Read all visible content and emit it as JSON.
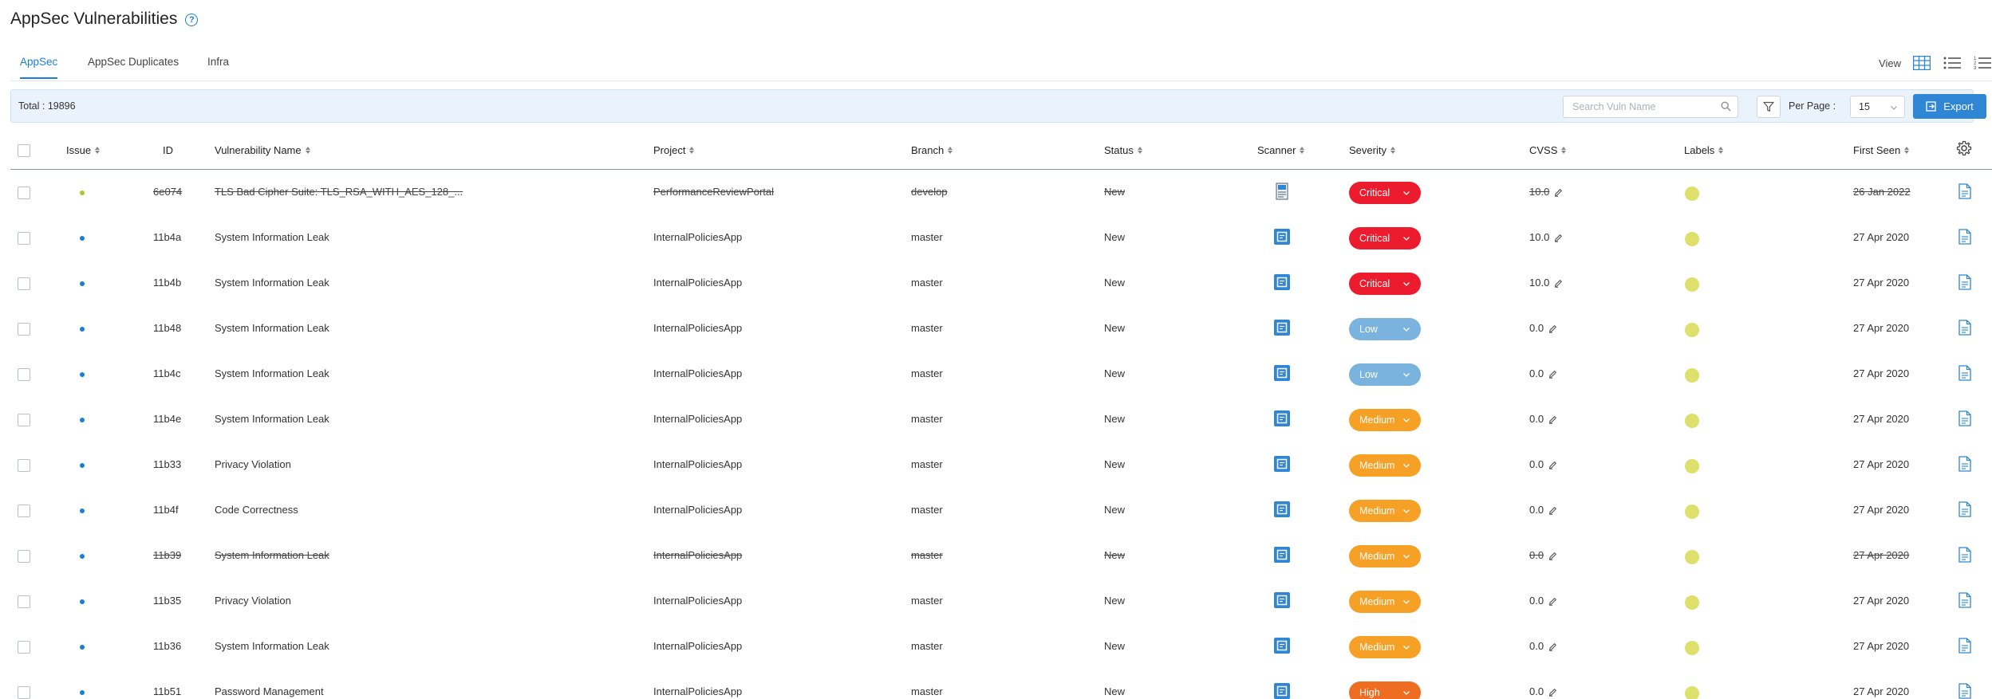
{
  "page": {
    "title": "AppSec Vulnerabilities",
    "help_icon": "help-circle-icon"
  },
  "tabs": [
    {
      "label": "AppSec",
      "active": true
    },
    {
      "label": "AppSec Duplicates",
      "active": false
    },
    {
      "label": "Infra",
      "active": false
    }
  ],
  "view": {
    "label": "View",
    "options": [
      "grid-view-icon",
      "list-view-icon",
      "numbered-list-view-icon"
    ],
    "selected": "grid-view-icon"
  },
  "toolbar": {
    "total": "Total : 19896",
    "search_placeholder": "Search Vuln Name",
    "per_page_label": "Per Page :",
    "per_page_value": "15",
    "export_label": "Export"
  },
  "columns": {
    "issue": "Issue",
    "id": "ID",
    "name": "Vulnerability Name",
    "project": "Project",
    "branch": "Branch",
    "status": "Status",
    "scanner": "Scanner",
    "severity": "Severity",
    "cvss": "CVSS",
    "labels": "Labels",
    "first_seen": "First Seen"
  },
  "colors": {
    "accent": "#1b7fd6",
    "critical": "#ec1c2e",
    "low": "#7ab4de",
    "medium": "#f6a126",
    "high": "#ef6d20",
    "label_dot": "#dde06a"
  },
  "rows": [
    {
      "issue_color": "#a9c838",
      "id": "6e074",
      "name": "TLS Bad Cipher Suite: TLS_RSA_WITH_AES_128_...",
      "project": "PerformanceReviewPortal",
      "branch": "develop",
      "status": "New",
      "scanner": "generic",
      "severity": "Critical",
      "severity_color": "#ec1c2e",
      "cvss": "10.0",
      "first_seen": "26 Jan 2022",
      "struck": true
    },
    {
      "issue_color": "#1b7fd6",
      "id": "11b4a",
      "name": "System Information Leak",
      "project": "InternalPoliciesApp",
      "branch": "master",
      "status": "New",
      "scanner": "sast",
      "severity": "Critical",
      "severity_color": "#ec1c2e",
      "cvss": "10.0",
      "first_seen": "27 Apr 2020",
      "struck": false
    },
    {
      "issue_color": "#1b7fd6",
      "id": "11b4b",
      "name": "System Information Leak",
      "project": "InternalPoliciesApp",
      "branch": "master",
      "status": "New",
      "scanner": "sast",
      "severity": "Critical",
      "severity_color": "#ec1c2e",
      "cvss": "10.0",
      "first_seen": "27 Apr 2020",
      "struck": false
    },
    {
      "issue_color": "#1b7fd6",
      "id": "11b48",
      "name": "System Information Leak",
      "project": "InternalPoliciesApp",
      "branch": "master",
      "status": "New",
      "scanner": "sast",
      "severity": "Low",
      "severity_color": "#7ab4de",
      "cvss": "0.0",
      "first_seen": "27 Apr 2020",
      "struck": false
    },
    {
      "issue_color": "#1b7fd6",
      "id": "11b4c",
      "name": "System Information Leak",
      "project": "InternalPoliciesApp",
      "branch": "master",
      "status": "New",
      "scanner": "sast",
      "severity": "Low",
      "severity_color": "#7ab4de",
      "cvss": "0.0",
      "first_seen": "27 Apr 2020",
      "struck": false
    },
    {
      "issue_color": "#1b7fd6",
      "id": "11b4e",
      "name": "System Information Leak",
      "project": "InternalPoliciesApp",
      "branch": "master",
      "status": "New",
      "scanner": "sast",
      "severity": "Medium",
      "severity_color": "#f6a126",
      "cvss": "0.0",
      "first_seen": "27 Apr 2020",
      "struck": false
    },
    {
      "issue_color": "#1b7fd6",
      "id": "11b33",
      "name": "Privacy Violation",
      "project": "InternalPoliciesApp",
      "branch": "master",
      "status": "New",
      "scanner": "sast",
      "severity": "Medium",
      "severity_color": "#f6a126",
      "cvss": "0.0",
      "first_seen": "27 Apr 2020",
      "struck": false
    },
    {
      "issue_color": "#1b7fd6",
      "id": "11b4f",
      "name": "Code Correctness",
      "project": "InternalPoliciesApp",
      "branch": "master",
      "status": "New",
      "scanner": "sast",
      "severity": "Medium",
      "severity_color": "#f6a126",
      "cvss": "0.0",
      "first_seen": "27 Apr 2020",
      "struck": false
    },
    {
      "issue_color": "#1b7fd6",
      "id": "11b39",
      "name": "System Information Leak",
      "project": "InternalPoliciesApp",
      "branch": "master",
      "status": "New",
      "scanner": "sast",
      "severity": "Medium",
      "severity_color": "#f6a126",
      "cvss": "0.0",
      "first_seen": "27 Apr 2020",
      "struck": true
    },
    {
      "issue_color": "#1b7fd6",
      "id": "11b35",
      "name": "Privacy Violation",
      "project": "InternalPoliciesApp",
      "branch": "master",
      "status": "New",
      "scanner": "sast",
      "severity": "Medium",
      "severity_color": "#f6a126",
      "cvss": "0.0",
      "first_seen": "27 Apr 2020",
      "struck": false
    },
    {
      "issue_color": "#1b7fd6",
      "id": "11b36",
      "name": "System Information Leak",
      "project": "InternalPoliciesApp",
      "branch": "master",
      "status": "New",
      "scanner": "sast",
      "severity": "Medium",
      "severity_color": "#f6a126",
      "cvss": "0.0",
      "first_seen": "27 Apr 2020",
      "struck": false
    },
    {
      "issue_color": "#1b7fd6",
      "id": "11b51",
      "name": "Password Management",
      "project": "InternalPoliciesApp",
      "branch": "master",
      "status": "New",
      "scanner": "sast",
      "severity": "High",
      "severity_color": "#ef6d20",
      "cvss": "0.0",
      "first_seen": "27 Apr 2020",
      "struck": false
    }
  ]
}
